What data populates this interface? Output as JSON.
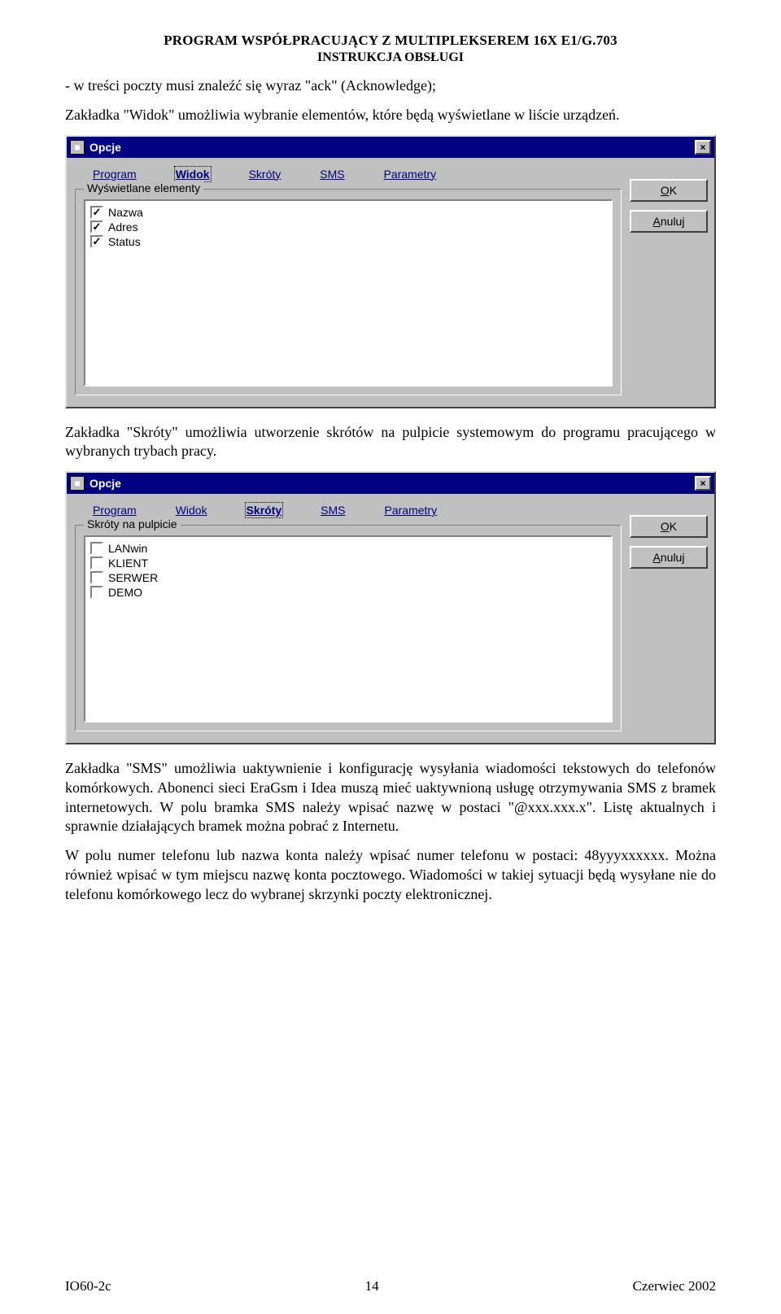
{
  "header": {
    "title_left": "P",
    "title_main": "ROGRAM WSPÓŁPRACUJĄCY Z ",
    "title_right": "MULTIPLEKSEREM 16X E1/G.703",
    "subtitle_left": "I",
    "subtitle_main": "NSTRUKCJA ",
    "subtitle_right": "O",
    "subtitle_end": "BSŁUGI"
  },
  "para1": "- w treści poczty musi znaleźć się wyraz \"ack\" (Acknowledge);",
  "para2": "Zakładka \"Widok\" umożliwia wybranie elementów, które będą wyświetlane w liście urządzeń.",
  "para3": "Zakładka \"Skróty\" umożliwia utworzenie skrótów na pulpicie systemowym do programu pracującego w wybranych trybach pracy.",
  "para4": "Zakładka \"SMS\" umożliwia uaktywnienie i konfigurację wysyłania wiadomości tekstowych do telefonów komórkowych. Abonenci sieci EraGsm i Idea muszą mieć uaktywnioną usługę otrzymywania SMS z bramek internetowych. W polu bramka SMS należy wpisać nazwę w postaci \"@xxx.xxx.x\". Listę aktualnych i sprawnie działających bramek można pobrać z Internetu.",
  "para5": "W polu numer telefonu lub nazwa konta należy wpisać numer telefonu w postaci: 48yyyxxxxxx. Można również wpisać w tym miejscu nazwę konta pocztowego. Wiadomości w takiej sytuacji będą wysyłane nie do telefonu komórkowego lecz do wybranej skrzynki poczty elektronicznej.",
  "dialog": {
    "title": "Opcje",
    "close_glyph": "×",
    "ok_u": "O",
    "ok_rest": "K",
    "cancel_u": "A",
    "cancel_rest": "nuluj",
    "tabs": {
      "program": "Program",
      "widok": "Widok",
      "skroty": "Skróty",
      "sms": "SMS",
      "parametry": "Parametry"
    }
  },
  "dlg1": {
    "legend": "Wyświetlane elementy",
    "items": [
      {
        "label": "Nazwa",
        "checked": true
      },
      {
        "label": "Adres",
        "checked": true
      },
      {
        "label": "Status",
        "checked": true
      }
    ]
  },
  "dlg2": {
    "legend": "Skróty na pulpicie",
    "items": [
      {
        "label": "LANwin",
        "checked": false
      },
      {
        "label": "KLIENT",
        "checked": false
      },
      {
        "label": "SERWER",
        "checked": false
      },
      {
        "label": "DEMO",
        "checked": false
      }
    ]
  },
  "footer": {
    "left": "IO60-2c",
    "center": "14",
    "right": "Czerwiec 2002"
  }
}
